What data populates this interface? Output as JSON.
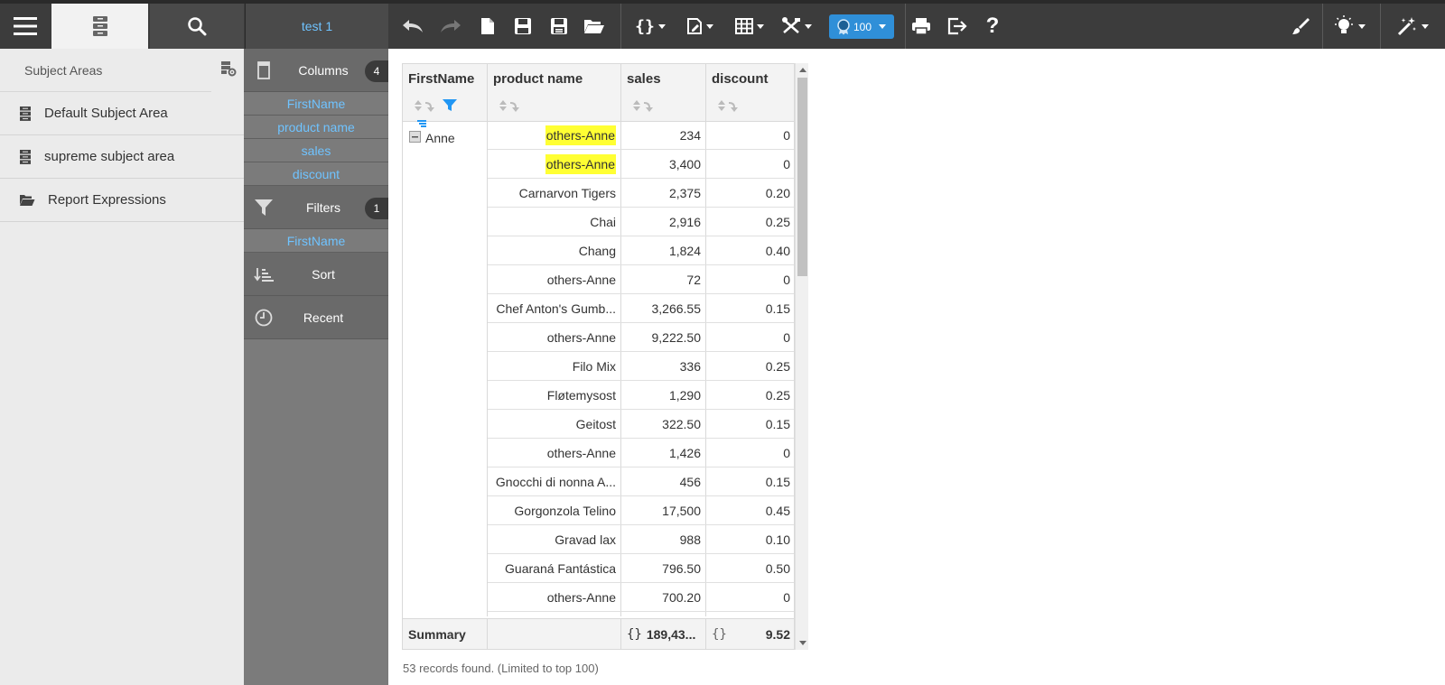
{
  "toolbar": {
    "report_title": "test 1",
    "badge_value": "100"
  },
  "subject_panel": {
    "header": "Subject Areas",
    "items": [
      {
        "label": "Default Subject Area",
        "icon": "database-icon"
      },
      {
        "label": "supreme subject area",
        "icon": "database-icon"
      },
      {
        "label": "Report Expressions",
        "icon": "folder-open-icon"
      }
    ]
  },
  "design_panel": {
    "columns_label": "Columns",
    "columns_count": "4",
    "column_fields": [
      "FirstName",
      "product name",
      "sales",
      "discount"
    ],
    "filters_label": "Filters",
    "filters_count": "1",
    "filter_fields": [
      "FirstName"
    ],
    "sort_label": "Sort",
    "recent_label": "Recent"
  },
  "grid": {
    "headers": [
      "FirstName",
      "product name",
      "sales",
      "discount"
    ],
    "group_value": "Anne",
    "rows": [
      {
        "product": "others-Anne",
        "sales": "234",
        "discount": "0",
        "highlight": true
      },
      {
        "product": "others-Anne",
        "sales": "3,400",
        "discount": "0",
        "highlight": true
      },
      {
        "product": "Carnarvon Tigers",
        "sales": "2,375",
        "discount": "0.20"
      },
      {
        "product": "Chai",
        "sales": "2,916",
        "discount": "0.25"
      },
      {
        "product": "Chang",
        "sales": "1,824",
        "discount": "0.40"
      },
      {
        "product": "others-Anne",
        "sales": "72",
        "discount": "0"
      },
      {
        "product": "Chef Anton's Gumb...",
        "sales": "3,266.55",
        "discount": "0.15"
      },
      {
        "product": "others-Anne",
        "sales": "9,222.50",
        "discount": "0"
      },
      {
        "product": "Filo Mix",
        "sales": "336",
        "discount": "0.25"
      },
      {
        "product": "Fløtemysost",
        "sales": "1,290",
        "discount": "0.25"
      },
      {
        "product": "Geitost",
        "sales": "322.50",
        "discount": "0.15"
      },
      {
        "product": "others-Anne",
        "sales": "1,426",
        "discount": "0"
      },
      {
        "product": "Gnocchi di nonna A...",
        "sales": "456",
        "discount": "0.15"
      },
      {
        "product": "Gorgonzola Telino",
        "sales": "17,500",
        "discount": "0.45"
      },
      {
        "product": "Gravad lax",
        "sales": "988",
        "discount": "0.10"
      },
      {
        "product": "Guaraná Fantástica",
        "sales": "796.50",
        "discount": "0.50"
      },
      {
        "product": "others-Anne",
        "sales": "700.20",
        "discount": "0"
      }
    ],
    "summary_label": "Summary",
    "summary_sales": "189,43...",
    "summary_discount": "9.52",
    "summary_icon_text": "{}"
  },
  "records_text": "53 records found. (Limited to top 100)",
  "colors": {
    "toolbar_bg": "#3c3c3c",
    "accent_blue": "#6fc3ff",
    "badge_blue": "#2f8fd8",
    "highlight_yellow": "#ffff33"
  }
}
